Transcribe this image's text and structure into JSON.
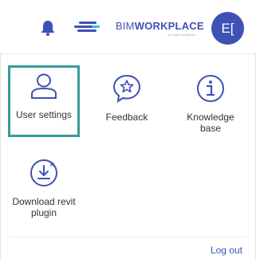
{
  "header": {
    "brand_part1": "BIM",
    "brand_part2": "WORKPLACE",
    "brand_tagline": "we make workflows",
    "avatar_initials": "E["
  },
  "menu": {
    "items": [
      {
        "label": "User settings",
        "icon": "user-icon"
      },
      {
        "label": "Feedback",
        "icon": "star-speech-bubble-icon"
      },
      {
        "label": "Knowledge\nbase",
        "icon": "info-icon"
      },
      {
        "label": "Download revit\nplugin",
        "icon": "download-icon"
      }
    ],
    "logout_label": "Log out"
  },
  "colors": {
    "accent": "#3f51b5",
    "selected_border": "#3a9a9c"
  }
}
